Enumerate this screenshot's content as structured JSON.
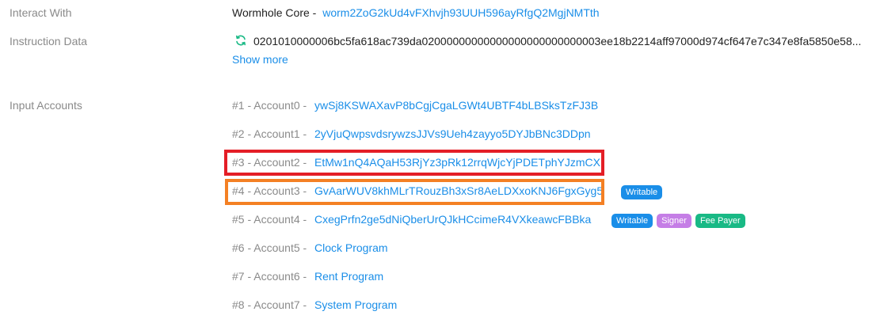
{
  "interact_with": {
    "label": "Interact With",
    "program_name": "Wormhole Core -",
    "program_address": "worm2ZoG2kUd4vFXhvjh93UUH596ayRfgQ2MgjNMTth"
  },
  "instruction_data": {
    "label": "Instruction Data",
    "value": "0201010000006bc5fa618ac739da02000000000000000000000000003ee18b2214aff97000d974cf647e7c347e8fa5850e58...",
    "show_more": "Show more"
  },
  "input_accounts": {
    "label": "Input Accounts",
    "accounts": [
      {
        "prefix": "#1 - Account0 -",
        "address": "ywSj8KSWAXavP8bCgjCgaLGWt4UBTF4bLBSksTzFJ3B"
      },
      {
        "prefix": "#2 - Account1 -",
        "address": "2yVjuQwpsvdsrywzsJJVs9Ueh4zayyo5DYJbBNc3DDpn"
      },
      {
        "prefix": "#3 - Account2 -",
        "address": "EtMw1nQ4AQaH53RjYz3pRk12rrqWjcYjPDETphYJzmCX"
      },
      {
        "prefix": "#4 - Account3 -",
        "address": "GvAarWUV8khMLrTRouzBh3xSr8AeLDXxoKNJ6FgxGyg5",
        "badges": [
          "Writable"
        ]
      },
      {
        "prefix": "#5 - Account4 -",
        "address": "CxegPrfn2ge5dNiQberUrQJkHCcimeR4VXkeawcFBBka",
        "badges": [
          "Writable",
          "Signer",
          "Fee Payer"
        ]
      },
      {
        "prefix": "#6 - Account5 -",
        "address": "Clock Program"
      },
      {
        "prefix": "#7 - Account6 -",
        "address": "Rent Program"
      },
      {
        "prefix": "#8 - Account7 -",
        "address": "System Program"
      }
    ]
  },
  "colors": {
    "link": "#1a8ee8",
    "writable_badge": "#1a8ee8",
    "signer_badge": "#c57ee6",
    "fee_payer_badge": "#19b985",
    "highlight_red": "#e41e26",
    "highlight_orange": "#f48024"
  },
  "icons": {
    "refresh": "refresh-icon"
  }
}
